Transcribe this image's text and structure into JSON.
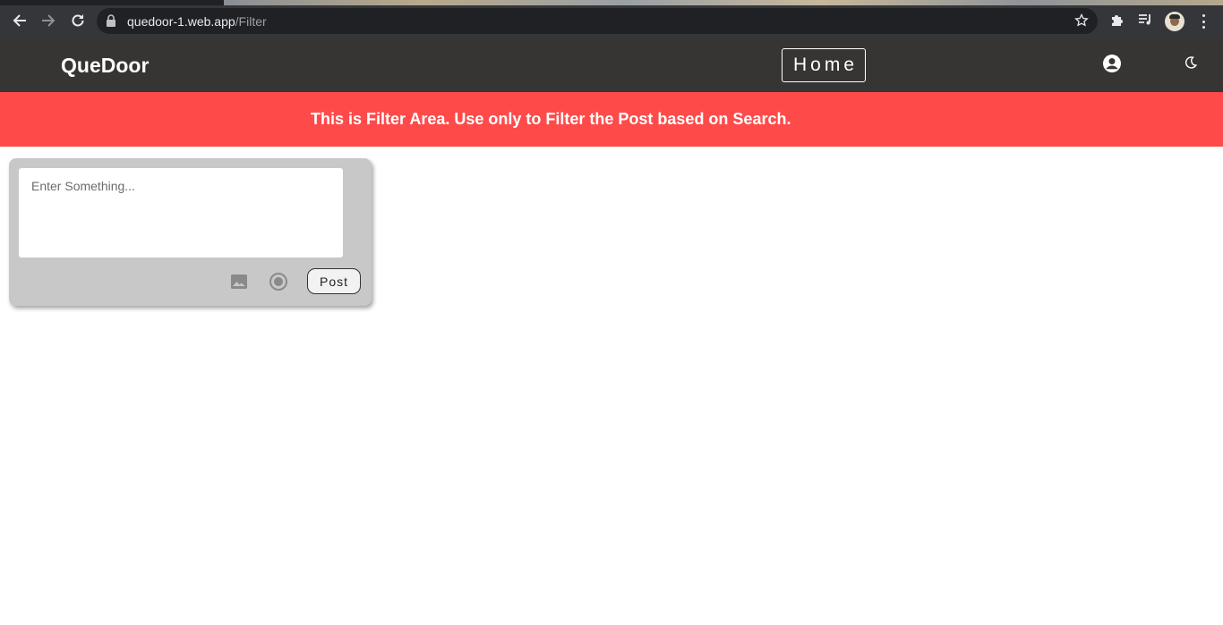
{
  "browser": {
    "url_host": "quedoor-1.web.app",
    "url_path": "/Filter"
  },
  "header": {
    "brand": "QueDoor",
    "home_label": "Home"
  },
  "banner": {
    "text": "This is Filter Area. Use only to Filter the Post based on Search.",
    "color": "#ff4a4a"
  },
  "post_card": {
    "input_placeholder": "Enter Something...",
    "input_value": "",
    "post_label": "Post",
    "icons": [
      "image-icon",
      "radio-icon"
    ]
  }
}
